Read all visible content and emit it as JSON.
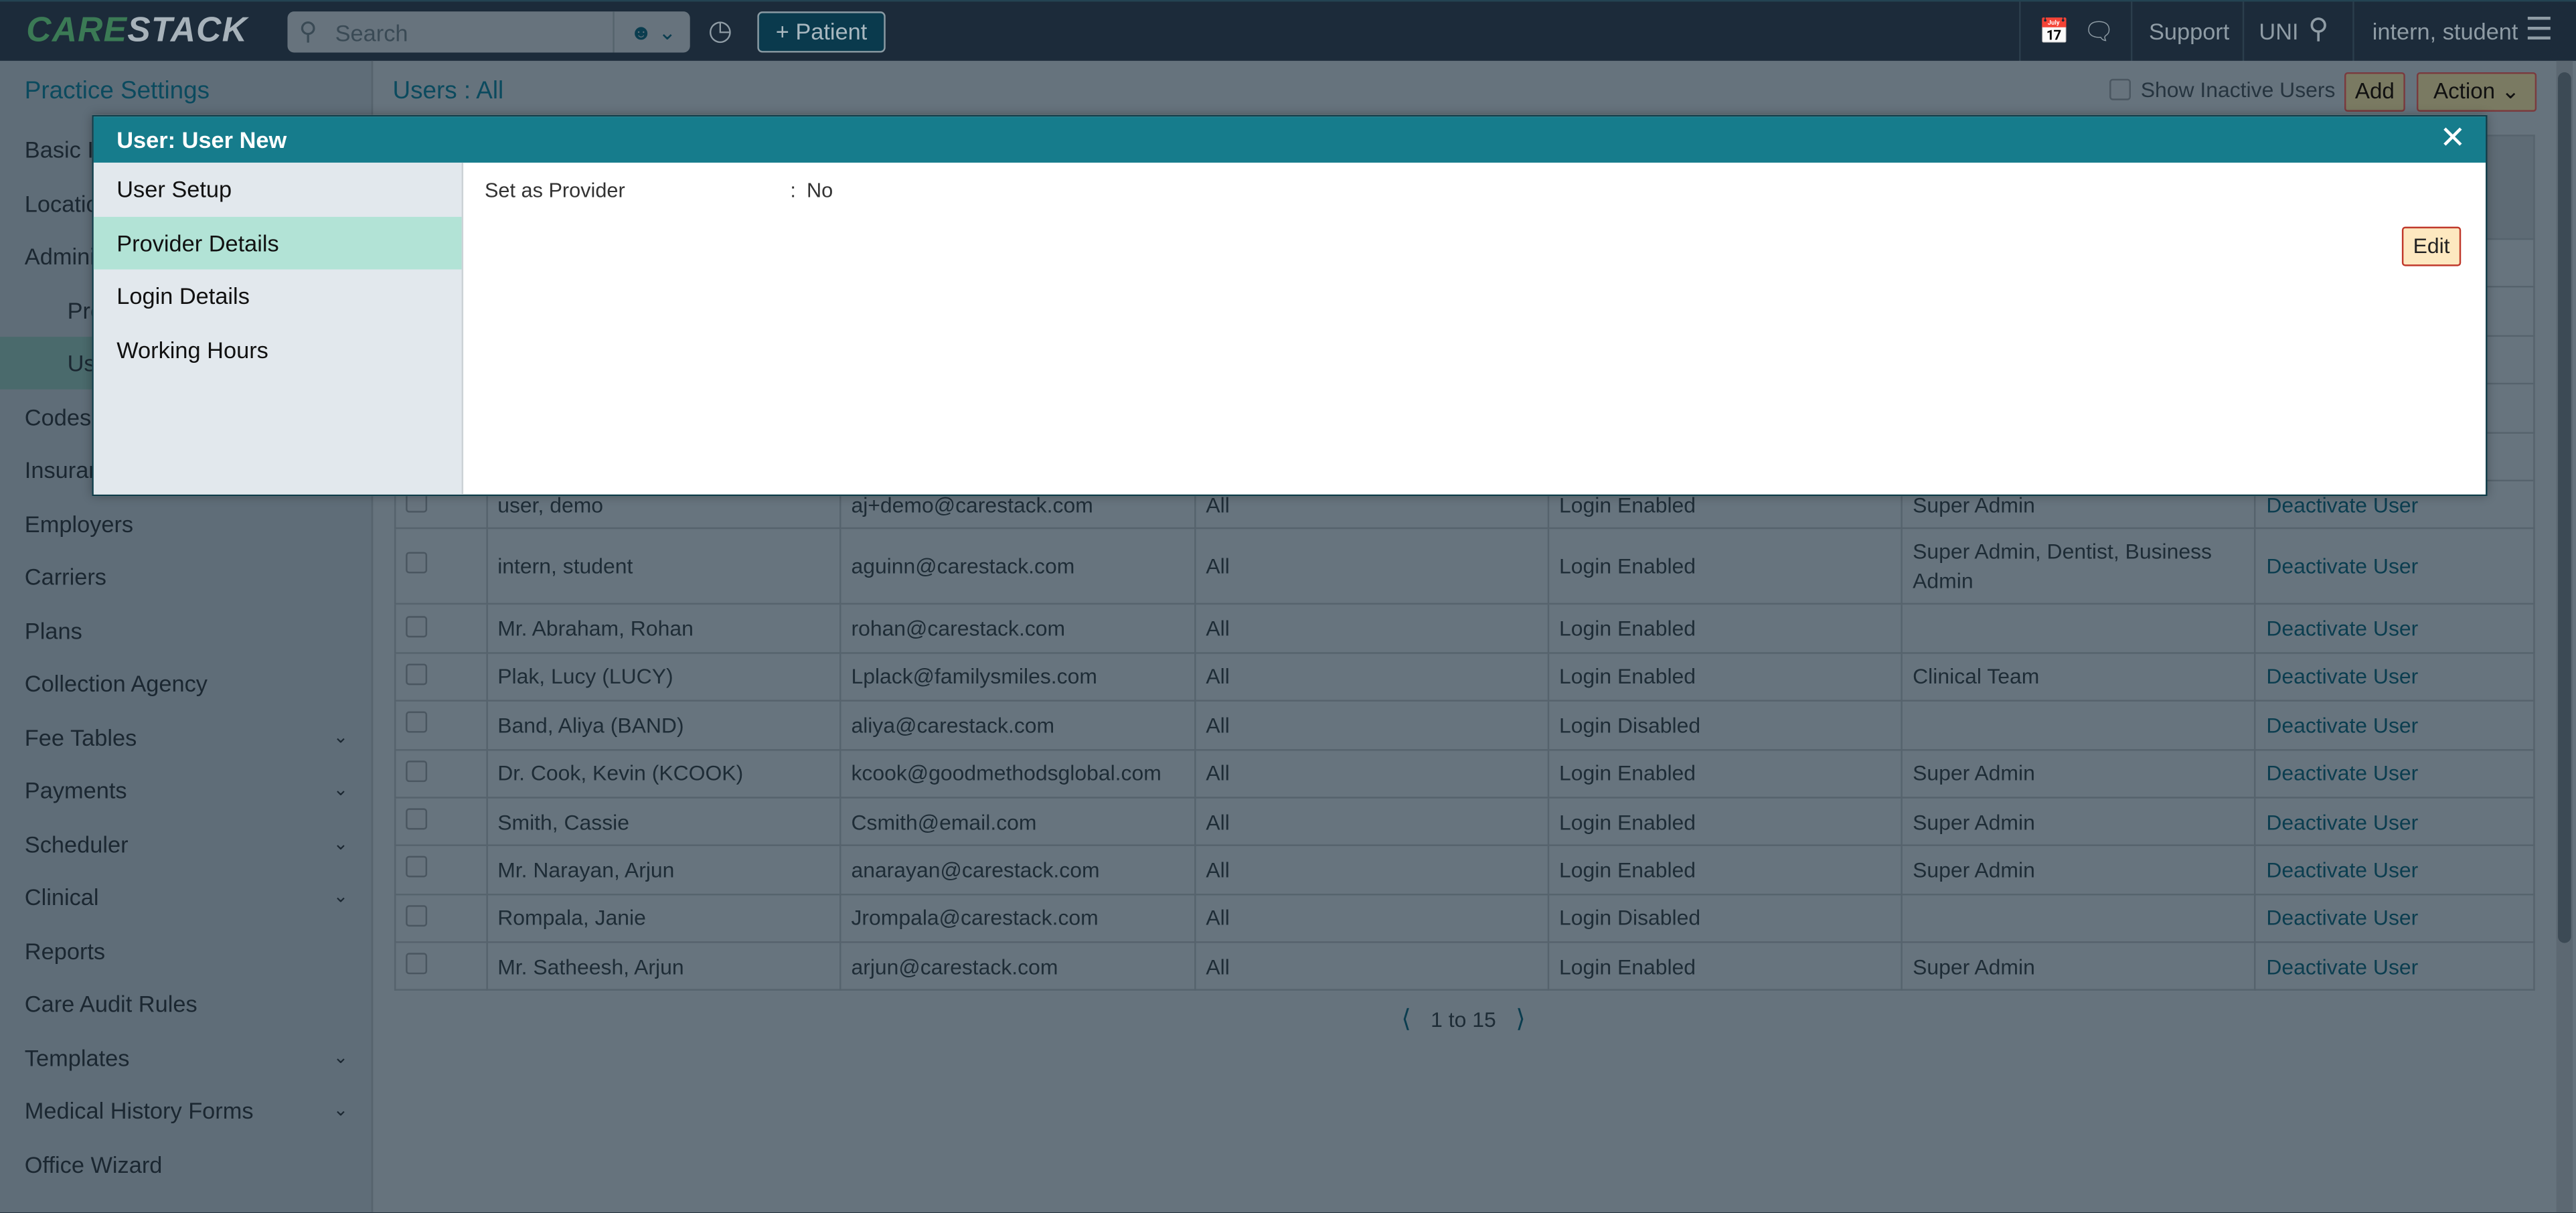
{
  "topbar": {
    "logo": {
      "part1": "CAR",
      "part2": "E",
      "part3": "STACK"
    },
    "search_placeholder": "Search",
    "add_patient_label": "+ Patient",
    "support_label": "Support",
    "location_label": "UNI",
    "user_label": "intern, student"
  },
  "sidebar": {
    "title": "Practice Settings",
    "items": [
      {
        "label": "Basic Info",
        "sub": false
      },
      {
        "label": "Locations",
        "sub": false
      },
      {
        "label": "Administration",
        "sub": false
      },
      {
        "label": "Providers",
        "sub": true
      },
      {
        "label": "Users",
        "sub": true,
        "active": true
      },
      {
        "label": "Codes",
        "sub": false
      },
      {
        "label": "Insurance",
        "sub": false
      },
      {
        "label": "Employers",
        "sub": false
      },
      {
        "label": "Carriers",
        "sub": false
      },
      {
        "label": "Plans",
        "sub": false
      },
      {
        "label": "Collection Agency",
        "sub": false
      },
      {
        "label": "Fee Tables",
        "sub": false,
        "expandable": true
      },
      {
        "label": "Payments",
        "sub": false,
        "expandable": true
      },
      {
        "label": "Scheduler",
        "sub": false,
        "expandable": true
      },
      {
        "label": "Clinical",
        "sub": false,
        "expandable": true
      },
      {
        "label": "Reports",
        "sub": false
      },
      {
        "label": "Care Audit Rules",
        "sub": false
      },
      {
        "label": "Templates",
        "sub": false,
        "expandable": true
      },
      {
        "label": "Medical History Forms",
        "sub": false,
        "expandable": true
      },
      {
        "label": "Office Wizard",
        "sub": false
      }
    ]
  },
  "main": {
    "title": "Users : All",
    "show_inactive_label": "Show Inactive Users",
    "show_inactive_checked": false,
    "add_label": "Add",
    "action_label": "Action",
    "rows": [
      {
        "name": "user, demo",
        "email": "aj+demo@carestack.com",
        "locations": "All",
        "login": "Login Enabled",
        "roles": "Super Admin",
        "action": "Deactivate User"
      },
      {
        "name": "intern, student",
        "email": "aguinn@carestack.com",
        "locations": "All",
        "login": "Login Enabled",
        "roles": "Super Admin, Dentist, Business Admin",
        "action": "Deactivate User"
      },
      {
        "name": "Mr. Abraham, Rohan",
        "email": "rohan@carestack.com",
        "locations": "All",
        "login": "Login Enabled",
        "roles": "",
        "action": "Deactivate User"
      },
      {
        "name": "Plak, Lucy (LUCY)",
        "email": "Lplack@familysmiles.com",
        "locations": "All",
        "login": "Login Enabled",
        "roles": "Clinical Team",
        "action": "Deactivate User"
      },
      {
        "name": "Band, Aliya (BAND)",
        "email": "aliya@carestack.com",
        "locations": "All",
        "login": "Login Disabled",
        "roles": "",
        "action": "Deactivate User"
      },
      {
        "name": "Dr. Cook, Kevin (KCOOK)",
        "email": "kcook@goodmethodsglobal.com",
        "locations": "All",
        "login": "Login Enabled",
        "roles": "Super Admin",
        "action": "Deactivate User"
      },
      {
        "name": "Smith, Cassie",
        "email": "Csmith@email.com",
        "locations": "All",
        "login": "Login Enabled",
        "roles": "Super Admin",
        "action": "Deactivate User"
      },
      {
        "name": "Mr. Narayan, Arjun",
        "email": "anarayan@carestack.com",
        "locations": "All",
        "login": "Login Enabled",
        "roles": "Super Admin",
        "action": "Deactivate User"
      },
      {
        "name": "Rompala, Janie",
        "email": "Jrompala@carestack.com",
        "locations": "All",
        "login": "Login Disabled",
        "roles": "",
        "action": "Deactivate User"
      },
      {
        "name": "Mr. Satheesh, Arjun",
        "email": "arjun@carestack.com",
        "locations": "All",
        "login": "Login Enabled",
        "roles": "Super Admin",
        "action": "Deactivate User"
      }
    ],
    "pagination": {
      "label": "1 to 15"
    }
  },
  "modal": {
    "title": "User: User New",
    "nav": [
      {
        "label": "User Setup"
      },
      {
        "label": "Provider Details",
        "active": true
      },
      {
        "label": "Login Details"
      },
      {
        "label": "Working Hours"
      }
    ],
    "field": {
      "label": "Set as Provider",
      "separator": ":",
      "value": "No"
    },
    "edit_label": "Edit"
  },
  "colors": {
    "modal_header": "#167c8c",
    "active_nav": "#b2e3d6",
    "link": "#0d6a82",
    "topbar": "#22384b"
  }
}
